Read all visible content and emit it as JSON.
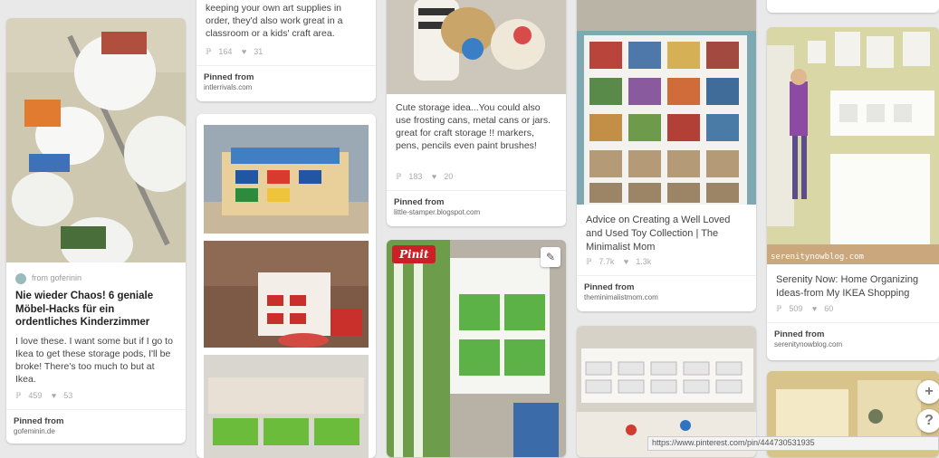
{
  "pins": [
    {
      "attribution": "from goferinin",
      "title": "Nie wieder Chaos! 6 geniale Möbel-Hacks für ein ordentliches Kinderzimmer",
      "description": "I love these. I want some but if I go to Ikea to get these storage pods, I'll be broke! There's too much to but at Ikea.",
      "repins": "459",
      "likes": "53",
      "pinned_label": "Pinned from",
      "source": "gofeminin.de",
      "image_icon": "white-pod-organizers-photo"
    },
    {
      "description": "keeping your own art supplies in order, they'd also work great in a classroom or a kids' craft area.",
      "repins": "164",
      "likes": "31",
      "pinned_label": "Pinned from",
      "source": "intlerrivals.com"
    },
    {
      "description": "Cute storage idea...You could also use frosting cans, metal cans or jars. great for craft storage !! markers, pens, pencils even paint brushes!",
      "repins": "183",
      "likes": "20",
      "pinned_label": "Pinned from",
      "source": "little-stamper.blogspot.com"
    },
    {
      "description": "Advice on Creating a Well Loved and Used Toy Collection | The Minimalist Mom",
      "repins": "7.7k",
      "likes": "1.3k",
      "pinned_label": "Pinned from",
      "source": "theminimalistmom.com"
    },
    {
      "description": "Serenity Now: Home Organizing Ideas-from My IKEA Shopping",
      "repins": "509",
      "likes": "60",
      "pinned_label": "Pinned from",
      "source": "serenitynowblog.com",
      "watermark": "serenitynowblog.com"
    }
  ],
  "pinit_label": "Pinit",
  "edit_icon": "pencil-icon",
  "fab_plus": "+",
  "fab_help": "?",
  "status_url": "https://www.pinterest.com/pin/444730531935",
  "repin_icon": "pin-icon",
  "like_icon": "heart-icon",
  "colors": {
    "pinit": "#cb2027",
    "background": "#e9e9e9"
  }
}
